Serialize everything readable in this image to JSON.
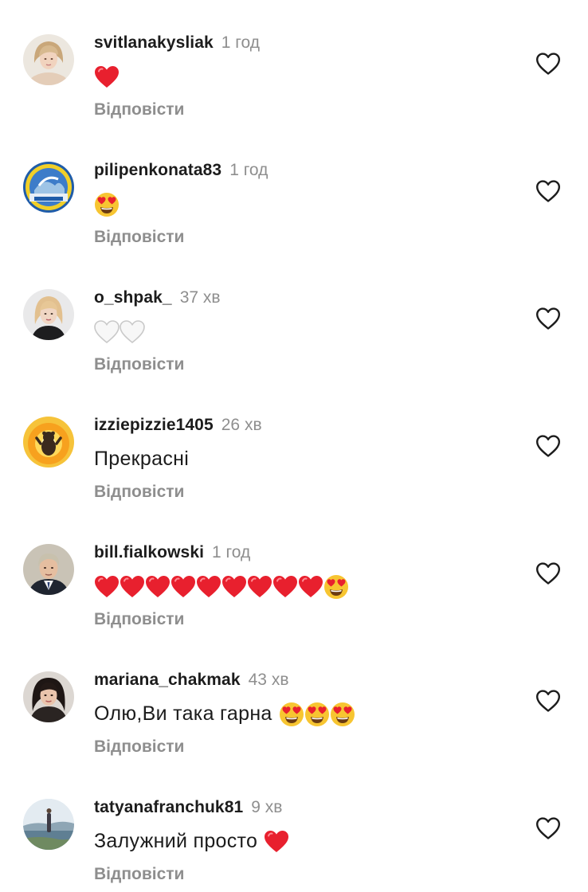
{
  "comments": [
    {
      "username": "svitlanakysliak",
      "time": "1 год",
      "text": "",
      "emojis": [
        "red-heart"
      ],
      "reply": "Відповісти",
      "avatar": "avatar-woman-light"
    },
    {
      "username": "pilipenkonata83",
      "time": "1 год",
      "text": "",
      "emojis": [
        "heart-eyes"
      ],
      "reply": "Відповісти",
      "avatar": "avatar-badge-ukraine"
    },
    {
      "username": "o_shpak_",
      "time": "37 хв",
      "text": "",
      "emojis": [
        "white-heart",
        "white-heart"
      ],
      "reply": "Відповісти",
      "avatar": "avatar-woman-blonde"
    },
    {
      "username": "izziepizzie1405",
      "time": "26 хв",
      "text": "Прекрасні",
      "emojis": [],
      "reply": "Відповісти",
      "avatar": "avatar-bear-explosion"
    },
    {
      "username": "bill.fialkowski",
      "time": "1 год",
      "text": "",
      "emojis": [
        "red-heart",
        "red-heart",
        "red-heart",
        "red-heart",
        "red-heart",
        "red-heart",
        "red-heart",
        "red-heart",
        "red-heart",
        "heart-eyes"
      ],
      "reply": "Відповісти",
      "avatar": "avatar-man-suit"
    },
    {
      "username": "mariana_chakmak",
      "time": "43 хв",
      "text": "Олю,Ви така гарна",
      "emojis": [
        "heart-eyes",
        "heart-eyes",
        "heart-eyes"
      ],
      "reply": "Відповісти",
      "avatar": "avatar-woman-dark"
    },
    {
      "username": "tatyanafranchuk81",
      "time": "9 хв",
      "text": "Залужний просто",
      "emojis": [
        "red-heart"
      ],
      "reply": "Відповісти",
      "avatar": "avatar-landscape"
    }
  ],
  "icons": {
    "like": "heart-outline-icon"
  },
  "colors": {
    "username": "#1c1c1c",
    "secondary": "#8e8e8e",
    "red_heart": "#e8202e",
    "emoji_yellow": "#f7c531"
  }
}
